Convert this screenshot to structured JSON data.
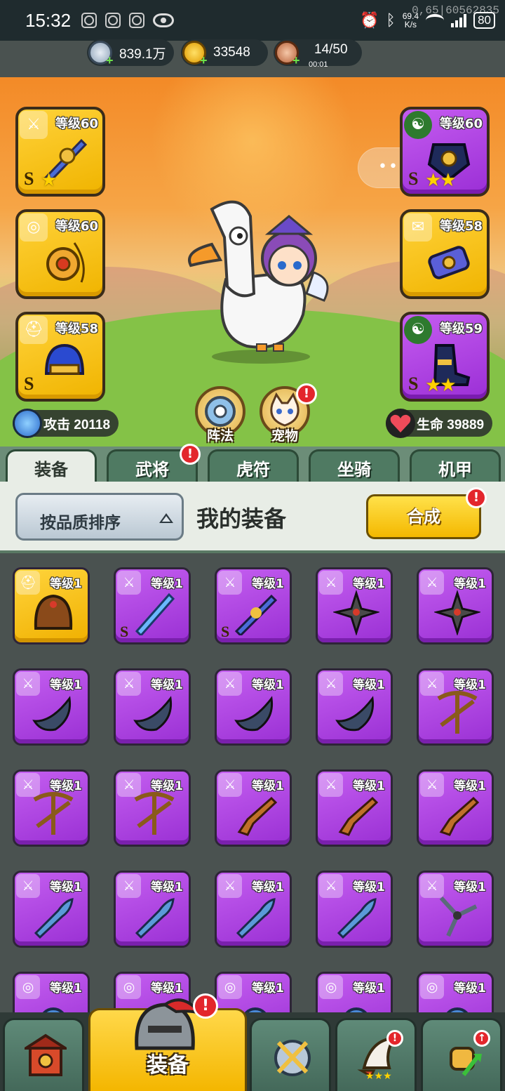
{
  "status_bar": {
    "time": "15:32",
    "net_speed_value": "69.4",
    "net_speed_unit": "K/s",
    "battery": "80",
    "overlay_text": "0,65|60562835"
  },
  "resources": {
    "silver": "839.1万",
    "gold": "33548",
    "stamina": "14/50",
    "stamina_timer": "00:01"
  },
  "hero": {
    "slots": [
      {
        "level": "等级60",
        "rarity": "S",
        "stars": "★",
        "color": "gold"
      },
      {
        "level": "等级60",
        "rarity": "",
        "stars": "",
        "color": "gold"
      },
      {
        "level": "等级58",
        "rarity": "S",
        "stars": "",
        "color": "gold"
      },
      {
        "level": "等级60",
        "rarity": "S",
        "stars": "★★",
        "color": "purple"
      },
      {
        "level": "等级58",
        "rarity": "",
        "stars": "",
        "color": "gold"
      },
      {
        "level": "等级59",
        "rarity": "S",
        "stars": "★★",
        "color": "purple"
      }
    ],
    "attack_label": "攻击 20118",
    "hp_label": "生命 39889",
    "formation_label": "阵法",
    "pet_label": "宠物",
    "alert_mark": "!"
  },
  "tabs": [
    "装备",
    "武将",
    "虎符",
    "坐骑",
    "机甲"
  ],
  "toolbar": {
    "sort_label": "按品质排序",
    "section_title": "我的装备",
    "merge_label": "合成"
  },
  "equipment_level": "等级1",
  "equipment_rarity": "S",
  "bottom_nav": {
    "equip_label": "装备"
  },
  "colors": {
    "gold_card": "#f5c20a",
    "purple_card": "#b146e4",
    "alert_red": "#e3262c",
    "merge_yellow": "#ffd21f"
  },
  "icons": [
    "weapon-icon",
    "medal-icon",
    "helmet-icon",
    "yin-yang-icon",
    "scroll-icon",
    "close-icon",
    "more-icon"
  ]
}
